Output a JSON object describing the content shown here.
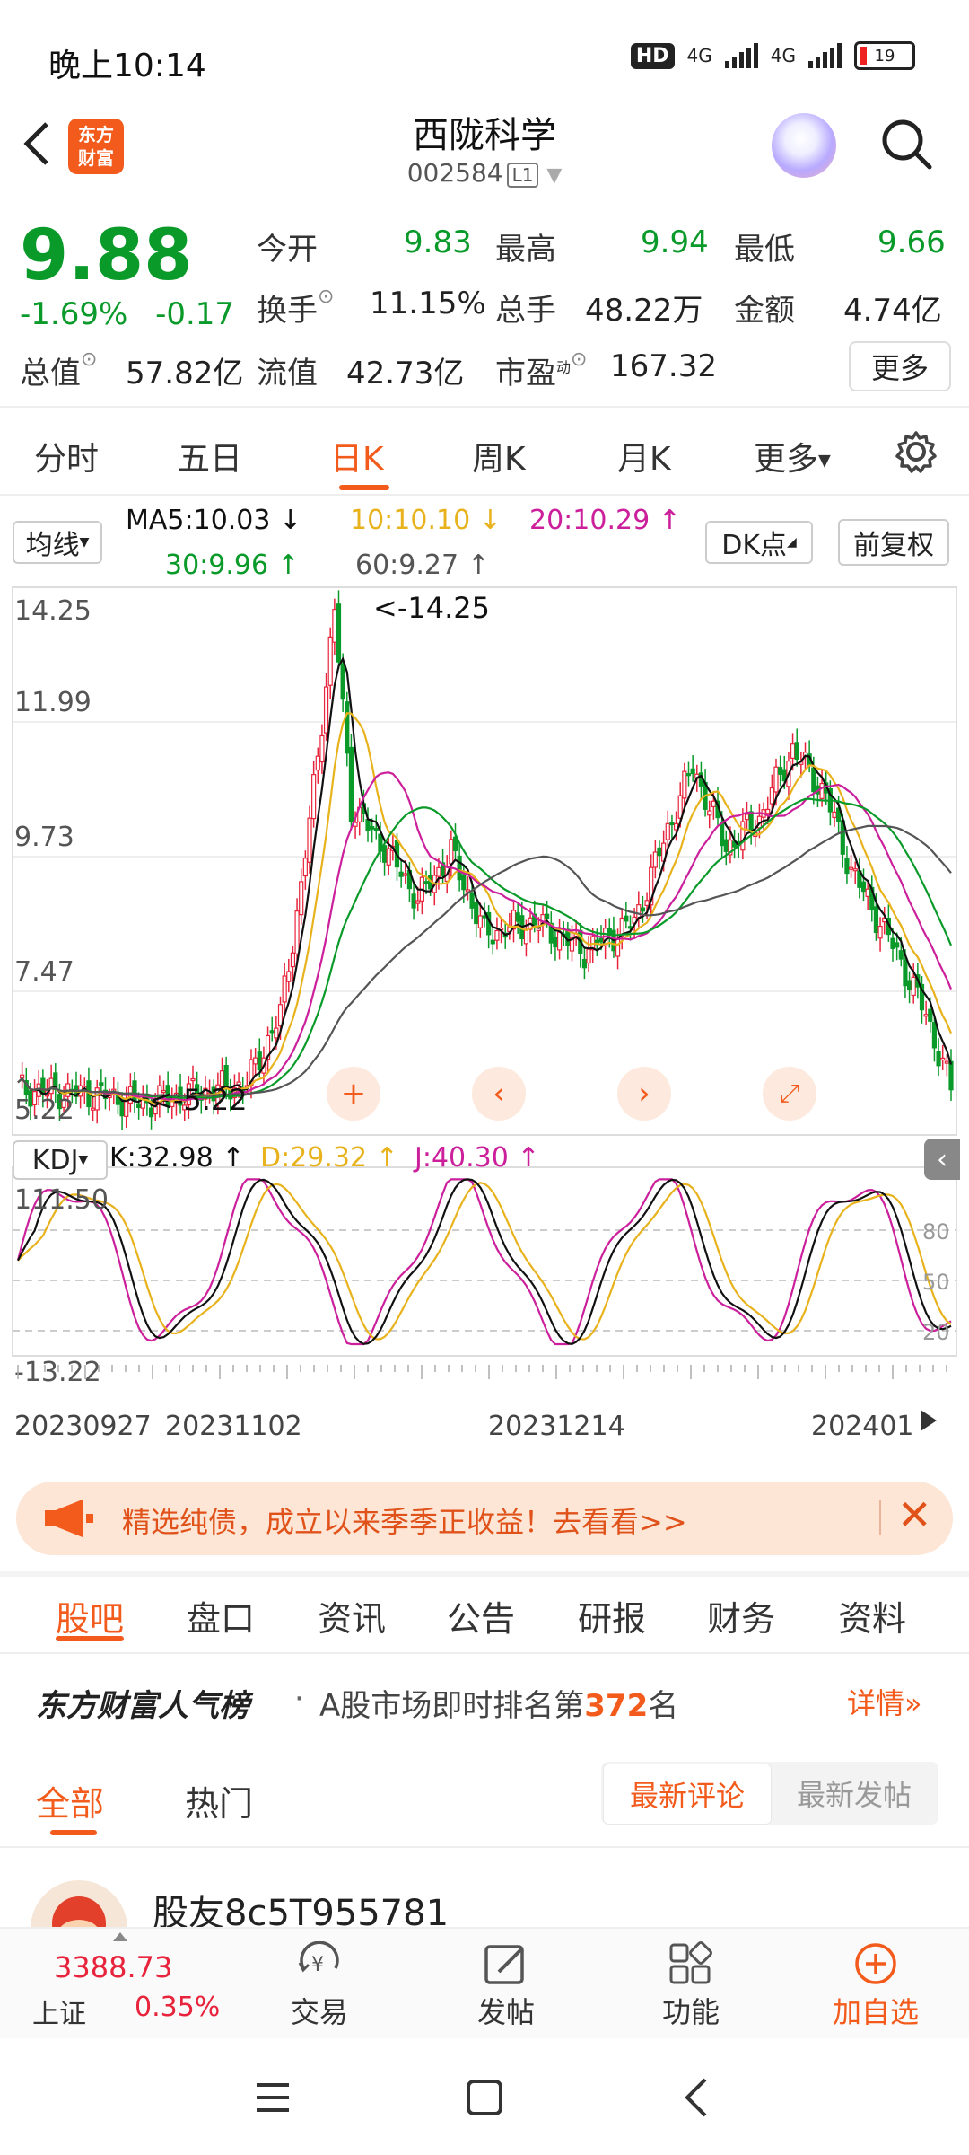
{
  "status_bar": {
    "time": "晚上10:14",
    "hd": "HD",
    "net1": "4G",
    "net2": "4G",
    "battery": "19"
  },
  "header": {
    "stock_name": "西陇科学",
    "stock_code": "002584",
    "level": "L1",
    "logo_text": "东方财富"
  },
  "quote": {
    "price": "9.88",
    "change_pct": "-1.69%",
    "change_abs": "-0.17",
    "open_label": "今开",
    "open": "9.83",
    "high_label": "最高",
    "high": "9.94",
    "low_label": "最低",
    "low": "9.66",
    "turnover_label": "换手",
    "turnover": "11.15%",
    "volume_label": "总手",
    "volume": "48.22万",
    "amount_label": "金额",
    "amount": "4.74亿",
    "mktcap_label": "总值",
    "mktcap": "57.82亿",
    "float_label": "流值",
    "float": "42.73亿",
    "pe_label": "市盈",
    "pe_sup": "动",
    "pe": "167.32",
    "more_label": "更多"
  },
  "tabs": [
    "分时",
    "五日",
    "日K",
    "周K",
    "月K",
    "更多"
  ],
  "active_tab": "日K",
  "ma_bar": {
    "selector": "均线",
    "ma5": "MA5:10.03 ↓",
    "ma10": "10:10.10 ↓",
    "ma20": "20:10.29 ↑",
    "ma30": "30:9.96 ↑",
    "ma60": "60:9.27 ↑",
    "dk": "DK点",
    "adjust": "前复权"
  },
  "colors": {
    "up": "#e8243c",
    "down": "#0a9a2a",
    "ma5": "#111111",
    "ma10": "#e8b21c",
    "ma20": "#cc1f9b",
    "ma30": "#0a9a2a",
    "ma60": "#555555",
    "accent": "#f35b1c"
  },
  "chart_data": [
    {
      "type": "candlestick",
      "yaxis_labels": [
        "14.25",
        "11.99",
        "9.73",
        "7.47",
        "5.22"
      ],
      "ylim": [
        5.22,
        14.25
      ],
      "max_annotation": "<-14.25",
      "min_annotation": "<-5.22",
      "x_labels": [
        "20230927",
        "20231102",
        "20231214",
        "202401"
      ]
    },
    {
      "type": "line",
      "indicator": "KDJ",
      "k": "K:32.98 ↑",
      "d": "D:29.32 ↑",
      "j": "J:40.30 ↑",
      "yaxis_labels": [
        "111.50",
        "-13.22"
      ],
      "ref_labels": [
        "80",
        "50",
        "20"
      ],
      "ylim": [
        -13.22,
        111.5
      ]
    }
  ],
  "banner": {
    "text": "精选纯债，成立以来季季正收益！去看看>>"
  },
  "sub_tabs": [
    "股吧",
    "盘口",
    "资讯",
    "公告",
    "研报",
    "财务",
    "资料"
  ],
  "active_sub_tab": "股吧",
  "rank": {
    "title": "东方财富人气榜",
    "dot": "·",
    "prefix": "A股市场即时排名第",
    "number": "372",
    "suffix": "名",
    "detail": "详情"
  },
  "feed_tabs": {
    "all": "全部",
    "hot": "热门",
    "latest_comment": "最新评论",
    "latest_post": "最新发帖"
  },
  "post": {
    "user": "股友8c5T955781"
  },
  "bottom_nav": {
    "index_value": "3388.73",
    "index_name": "上证",
    "index_change": "0.35%",
    "trade": "交易",
    "post": "发帖",
    "function": "功能",
    "add": "加自选"
  }
}
